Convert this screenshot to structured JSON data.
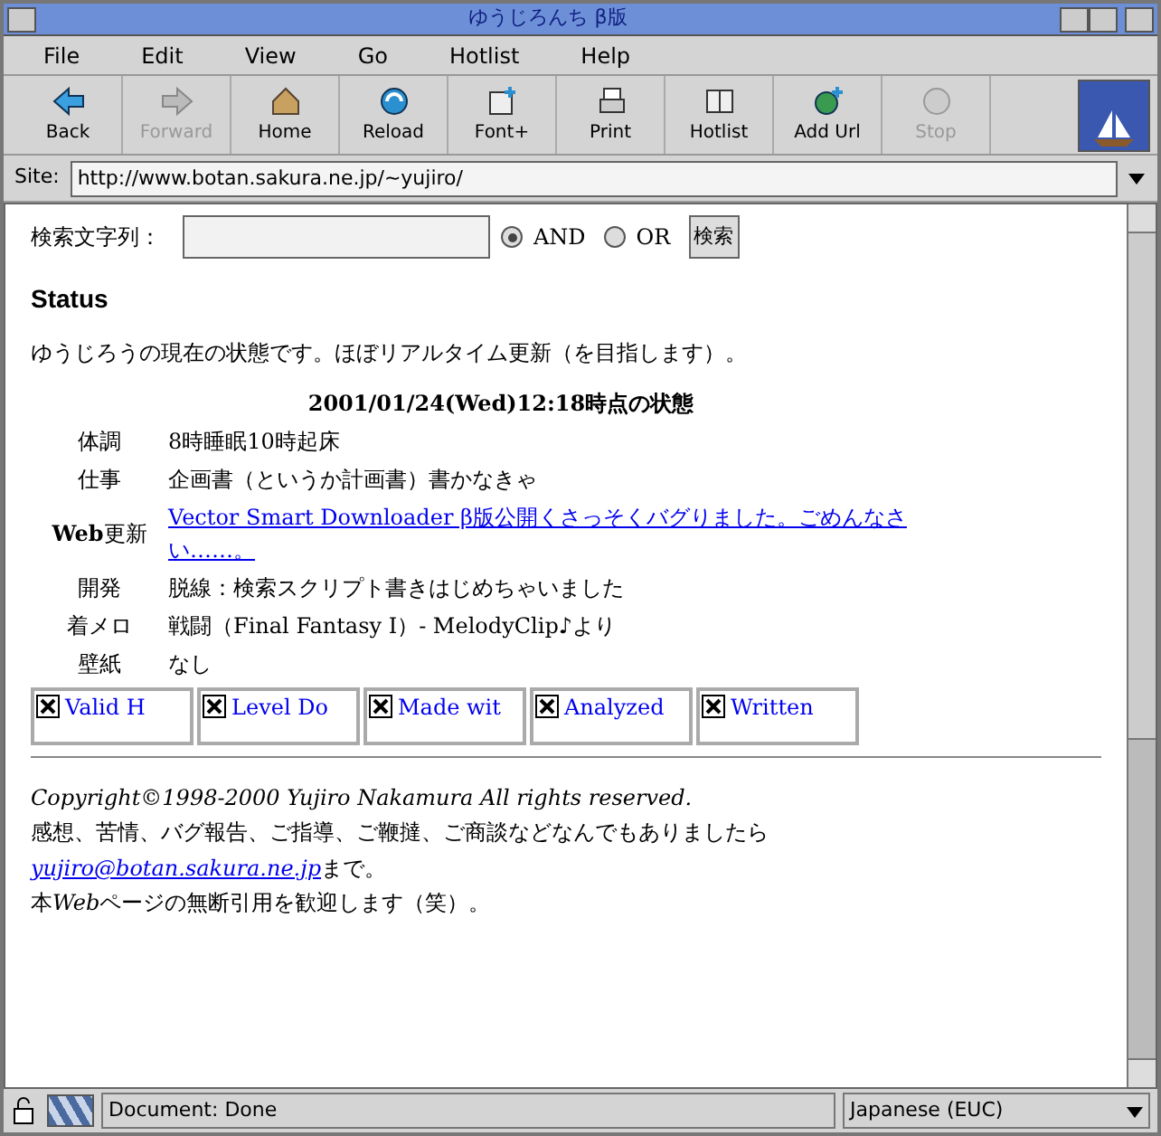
{
  "window": {
    "title": "ゆうじろんち β版"
  },
  "menu": [
    "File",
    "Edit",
    "View",
    "Go",
    "Hotlist",
    "Help"
  ],
  "toolbar": [
    {
      "label": "Back",
      "kind": "back",
      "disabled": false
    },
    {
      "label": "Forward",
      "kind": "forward",
      "disabled": true
    },
    {
      "label": "Home",
      "kind": "home",
      "disabled": false
    },
    {
      "label": "Reload",
      "kind": "reload",
      "disabled": false
    },
    {
      "label": "Font+",
      "kind": "font",
      "disabled": false
    },
    {
      "label": "Print",
      "kind": "print",
      "disabled": false
    },
    {
      "label": "Hotlist",
      "kind": "hotlist",
      "disabled": false
    },
    {
      "label": "Add Url",
      "kind": "addurl",
      "disabled": false
    },
    {
      "label": "Stop",
      "kind": "stop",
      "disabled": true
    }
  ],
  "site": {
    "label": "Site:",
    "value": "http://www.botan.sakura.ne.jp/~yujiro/"
  },
  "search": {
    "label": "検索文字列：",
    "options": [
      {
        "label": "AND",
        "selected": true
      },
      {
        "label": "OR",
        "selected": false
      }
    ],
    "button": "検索"
  },
  "heading": "Status",
  "intro": "ゆうじろうの現在の状態です。ほぼリアルタイム更新（を目指します）。",
  "table": {
    "caption": "2001/01/24(Wed)12:18時点の状態",
    "rows": [
      {
        "label": "体調",
        "value": "8時睡眠10時起床",
        "kind": "text"
      },
      {
        "label": "仕事",
        "value": "企画書（というか計画書）書かなきゃ",
        "kind": "text"
      },
      {
        "label": "**Web**更新",
        "value": "Vector Smart Downloader β版公開くさっそくバグりました。ごめんなさい……。",
        "kind": "link"
      },
      {
        "label": "開発",
        "value": "脱線：検索スクリプト書きはじめちゃいました",
        "kind": "text"
      },
      {
        "label": "着メロ",
        "value": "戦闘（Final Fantasy I）- MelodyClip♪より",
        "kind": "text"
      },
      {
        "label": "壁紙",
        "value": "なし",
        "kind": "text"
      }
    ]
  },
  "badges": [
    "Valid H",
    "Level Do",
    "Made wit",
    "Analyzed",
    "Written"
  ],
  "footer": {
    "copyright": "Copyright©1998-2000 Yujiro Nakamura All rights reserved.",
    "contact_before": "感想、苦情、バグ報告、ご指導、ご鞭撻、ご商談などなんでもありましたら",
    "email": "yujiro@botan.sakura.ne.jp",
    "contact_after": "まで。",
    "note": {
      "before": "本",
      "web": "Web",
      "after": "ページの無断引用を歓迎します（笑）。"
    }
  },
  "status_bar": {
    "text": "Document: Done",
    "encoding": "Japanese (EUC)"
  }
}
